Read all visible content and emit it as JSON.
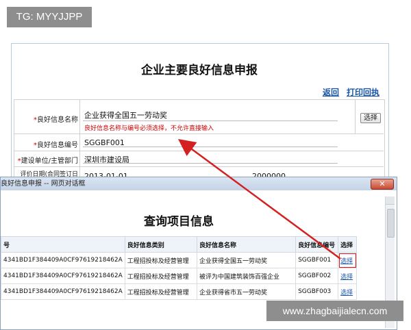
{
  "watermark_top": "TG: MYYJJPP",
  "watermark_bottom": "www.zhagbaijialecn.com",
  "form": {
    "title": "企业主要良好信息申报",
    "back_link": "返回",
    "print_link": "打印回执",
    "fields": {
      "name_label": "良好信息名称",
      "name_value": "企业获得全国五一劳动奖",
      "name_warning": "良好信息名称与编号必须选择，不允许直接输入",
      "select_button": "选择",
      "code_label": "良好信息编号",
      "code_value": "SGGBF001",
      "dept_label": "建设单位/主管部门",
      "dept_value": "深圳市建设局",
      "date_label": "评价日期(合同签订日",
      "date_value": "2013-01-01",
      "extra_value": "2000000"
    },
    "required_mark": "*"
  },
  "dialog": {
    "title": "良好信息申报 -- 网页对话框",
    "close_symbol": "✕",
    "heading": "查询项目信息",
    "columns": [
      "号",
      "良好信息类别",
      "良好信息名称",
      "良好信息编号",
      "选择"
    ],
    "rows": [
      {
        "id": "4341BD1F384409A0CF97619218462A",
        "category": "工程招投标及经营管理",
        "name": "企业获得全国五一劳动奖",
        "code": "SGGBF001",
        "action": "选择"
      },
      {
        "id": "4341BD1F384409A0CF97619218462A",
        "category": "工程招投标及经营管理",
        "name": "被评为中国建筑装饰百强企业",
        "code": "SGGBF002",
        "action": "选择"
      },
      {
        "id": "4341BD1F384409A0CF97619218462A",
        "category": "工程招投标及经营管理",
        "name": "企业获得省市五一劳动奖",
        "code": "SGGBF003",
        "action": "选择"
      }
    ]
  },
  "colors": {
    "link": "#1a56a8",
    "warning": "#cc0000",
    "arrow": "#d42020"
  }
}
